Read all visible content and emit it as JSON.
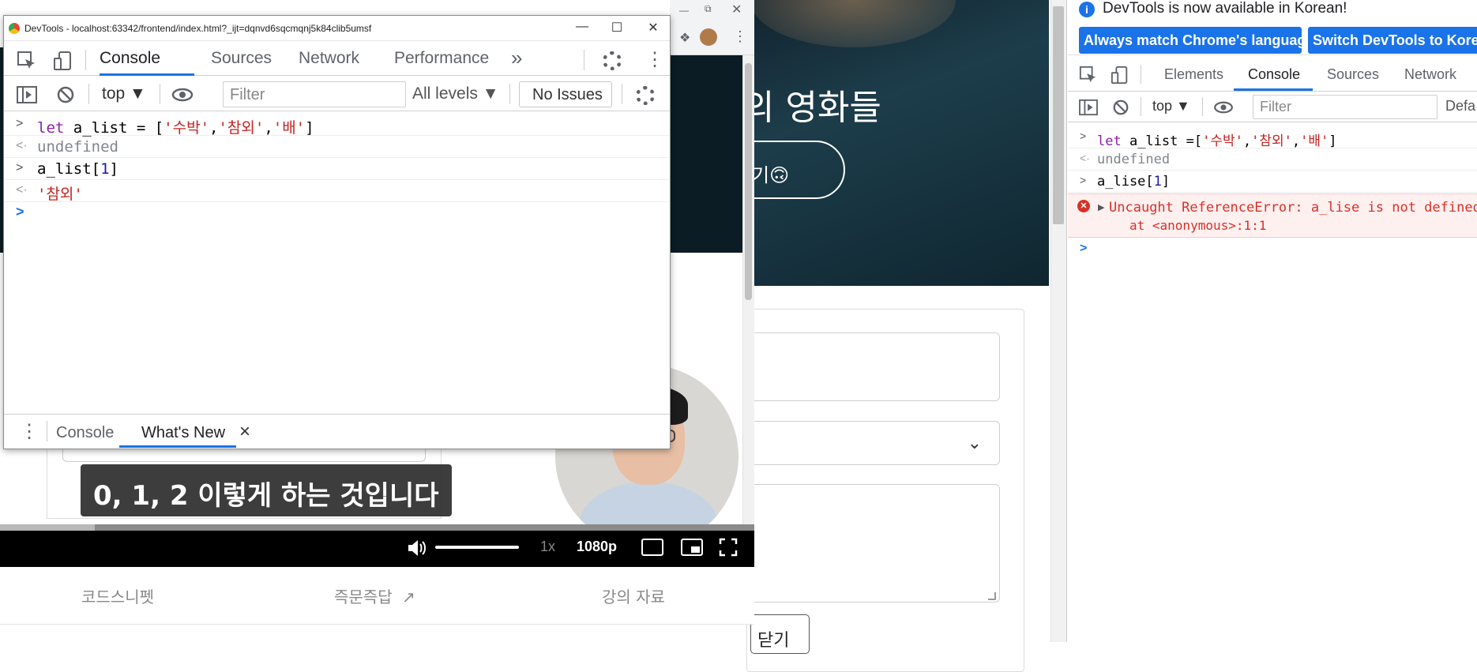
{
  "background_page": {
    "hero_title": "의 영화들",
    "hero_button_label": "기🙃",
    "close_button_label": "닫기"
  },
  "video": {
    "caption": "0, 1, 2 이렇게 하는 것입니다",
    "speed": "1x",
    "quality": "1080p",
    "progress_fraction": 0.125,
    "volume_fraction": 1.0
  },
  "lecture_tabs": [
    {
      "label": "코드스니펫"
    },
    {
      "label": "즉문즉답"
    },
    {
      "label": "강의 자료"
    }
  ],
  "floating_devtools": {
    "window_title": "DevTools - localhost:63342/frontend/index.html?_ijt=dqnvd6sqcmqnj5k84clib5umsf",
    "tabs": [
      "Console",
      "Sources",
      "Network",
      "Performance"
    ],
    "active_tab": "Console",
    "more_tabs": "»",
    "context": "top ▼",
    "filter_placeholder": "Filter",
    "levels": "All levels ▼",
    "issues": "No Issues",
    "console": {
      "l1_kw": "let",
      "l1_var": " a_list = [",
      "s1": "'수박'",
      "comma": ",",
      "s2": "'참외'",
      "s3": "'배'",
      "close": "]",
      "l2": "undefined",
      "l3_var": "a_list[",
      "l3_idx": "1",
      "l3_close": "]",
      "l4": "'참외'"
    },
    "drawer_tabs": [
      "Console",
      "What's New"
    ],
    "drawer_close": "×"
  },
  "docked_devtools": {
    "info_text": "DevTools is now available in Korean!",
    "button_match": "Always match Chrome's language",
    "button_switch": "Switch DevTools to Korean",
    "tabs": [
      "Elements",
      "Console",
      "Sources",
      "Network"
    ],
    "active_tab": "Console",
    "context": "top ▼",
    "filter_placeholder": "Filter",
    "default_levels": "Defa",
    "console": {
      "l1_kw": "let",
      "l1_var": " a_list =[",
      "s1": "'수박'",
      "comma": ",",
      "s2": "'참외'",
      "s3": "'배'",
      "close": "]",
      "l2": "undefined",
      "l3_var": "a_lise[",
      "l3_idx": "1",
      "l3_close": "]",
      "error_line1": "Uncaught ReferenceError: a_lise is not defined",
      "error_line2": "at <anonymous>:1:1"
    }
  },
  "colors": {
    "accent": "#1a73e8",
    "error": "#d93025",
    "keyword": "#8e1ea8",
    "string": "#c5221f"
  }
}
